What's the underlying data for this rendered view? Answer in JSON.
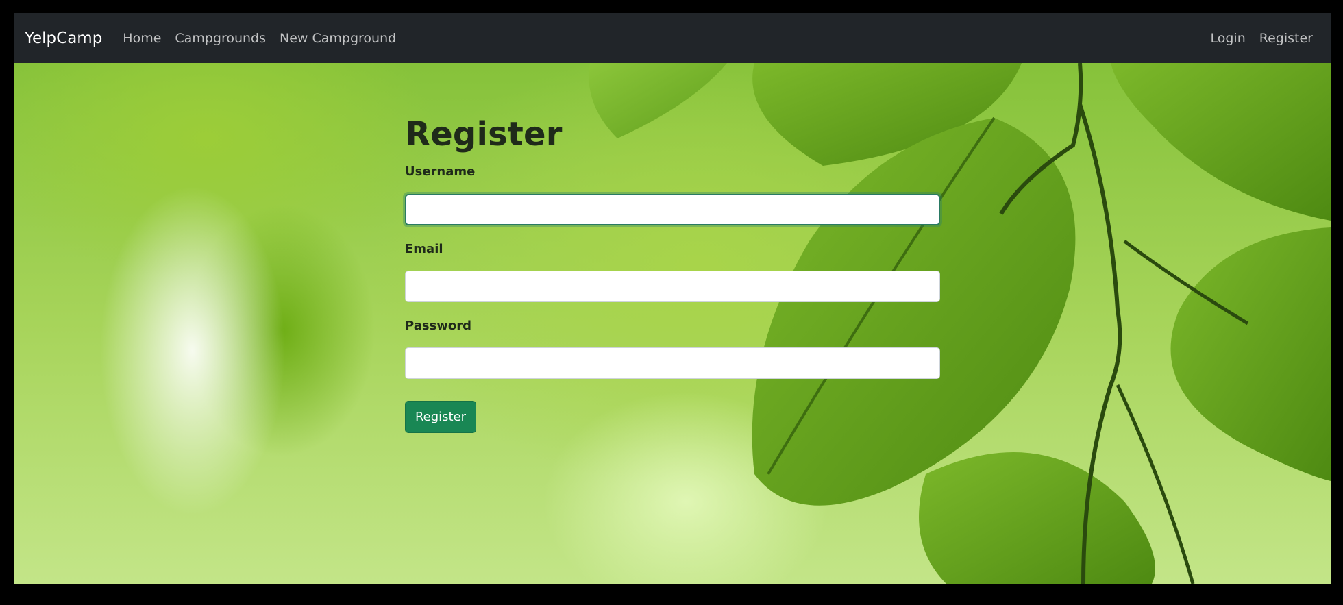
{
  "navbar": {
    "brand": "YelpCamp",
    "left_links": [
      "Home",
      "Campgrounds",
      "New Campground"
    ],
    "right_links": [
      "Login",
      "Register"
    ]
  },
  "form": {
    "title": "Register",
    "fields": [
      {
        "label": "Username",
        "value": "",
        "focused": true
      },
      {
        "label": "Email",
        "value": "",
        "focused": false
      },
      {
        "label": "Password",
        "value": "",
        "focused": false
      }
    ],
    "submit_label": "Register"
  },
  "colors": {
    "navbar_bg": "#212529",
    "submit_bg": "#198754",
    "background_theme": "green-leaves"
  },
  "background_image": "green-leaves-icon"
}
